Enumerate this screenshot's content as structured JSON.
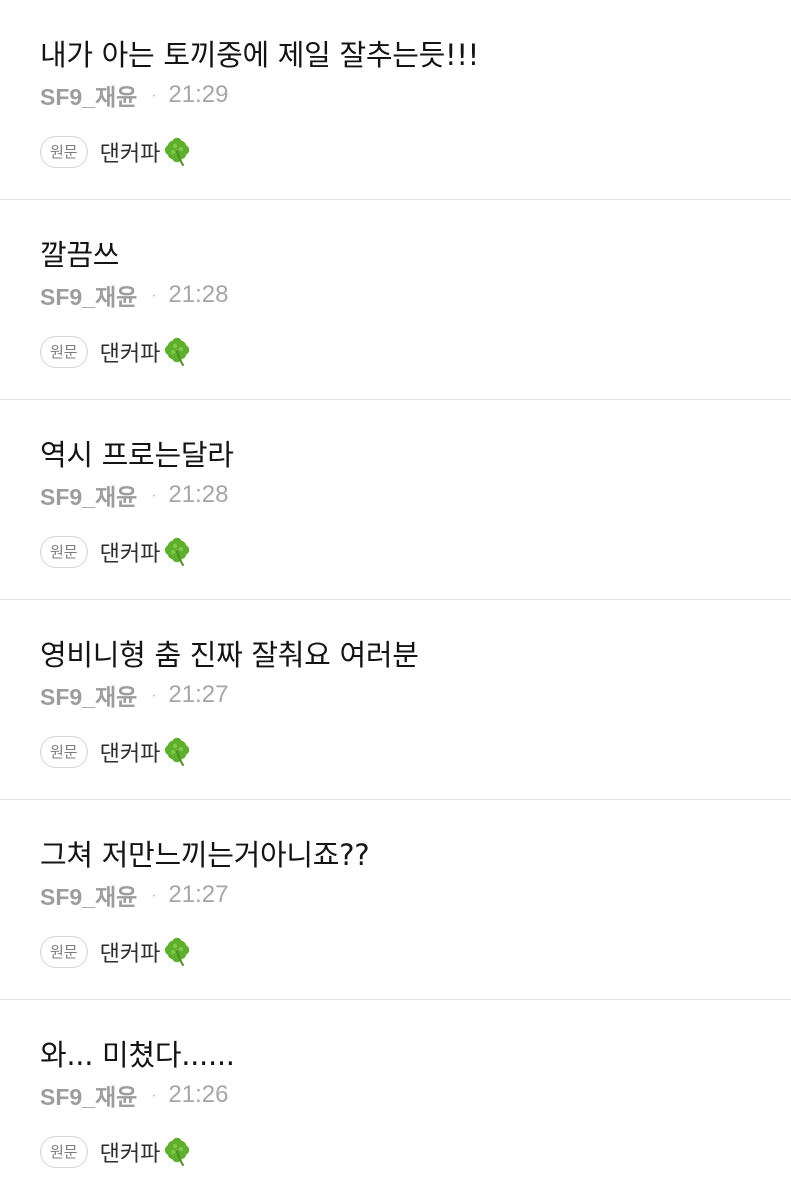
{
  "comments": [
    {
      "text": "내가 아는 토끼중에 제일 잘추는듯!!!",
      "author": "SF9_재윤",
      "separator": "·",
      "time": "21:29",
      "original_label": "원문",
      "tag": "댄커파",
      "tag_icon": "four-leaf-clover-icon"
    },
    {
      "text": "깔끔쓰",
      "author": "SF9_재윤",
      "separator": "·",
      "time": "21:28",
      "original_label": "원문",
      "tag": "댄커파",
      "tag_icon": "four-leaf-clover-icon"
    },
    {
      "text": "역시 프로는달라",
      "author": "SF9_재윤",
      "separator": "·",
      "time": "21:28",
      "original_label": "원문",
      "tag": "댄커파",
      "tag_icon": "four-leaf-clover-icon"
    },
    {
      "text": "영비니형 춤 진짜 잘춰요 여러분",
      "author": "SF9_재윤",
      "separator": "·",
      "time": "21:27",
      "original_label": "원문",
      "tag": "댄커파",
      "tag_icon": "four-leaf-clover-icon"
    },
    {
      "text": "그쳐 저만느끼는거아니죠??",
      "author": "SF9_재윤",
      "separator": "·",
      "time": "21:27",
      "original_label": "원문",
      "tag": "댄커파",
      "tag_icon": "four-leaf-clover-icon"
    },
    {
      "text": "와... 미쳤다......",
      "author": "SF9_재윤",
      "separator": "·",
      "time": "21:26",
      "original_label": "원문",
      "tag": "댄커파",
      "tag_icon": "four-leaf-clover-icon"
    }
  ],
  "colors": {
    "text": "#141414",
    "meta": "#a0a0a0",
    "divider": "#e3e3e3",
    "clover": "#5fae2e"
  }
}
